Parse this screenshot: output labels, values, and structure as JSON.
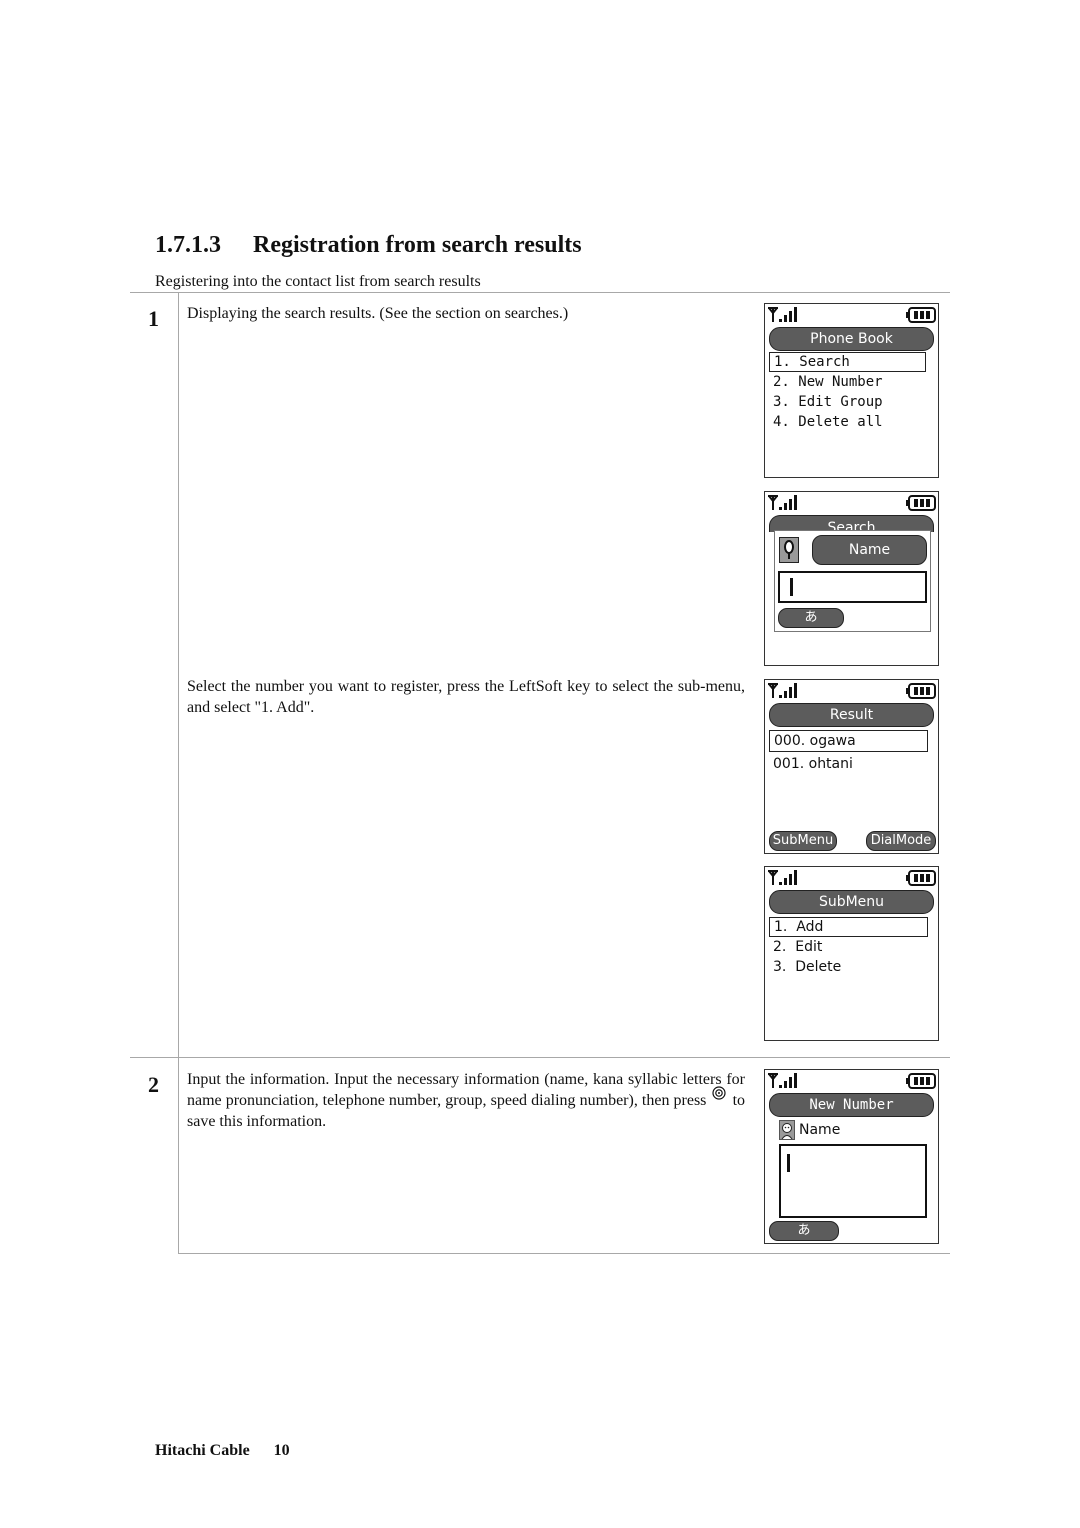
{
  "section": {
    "number": "1.7.1.3",
    "title": "Registration from search results",
    "subtitle": "Registering into the contact list from search results"
  },
  "steps": [
    {
      "number": "1",
      "paragraphs": [
        "Displaying the search results. (See the section on searches.)",
        "Select the number you want to register, press the LeftSoft key to select the sub-menu, and select \"1. Add\"."
      ]
    },
    {
      "number": "2",
      "text_before_icon": "Input the information. Input the necessary information (name, kana syllabic letters for name pronunciation, telephone number, group, speed dialing number), then press",
      "icon": "center-select-key-icon",
      "text_after_icon": "to save this information."
    }
  ],
  "screens": {
    "phone_book": {
      "title": "Phone Book",
      "items": [
        "1. Search",
        "2. New Number",
        "3. Edit Group",
        "4. Delete all"
      ],
      "selected_index": 0
    },
    "search": {
      "title": "Search",
      "field_label": "Name",
      "input_value": "",
      "input_mode": "あ"
    },
    "result": {
      "title": "Result",
      "items": [
        "000. ogawa",
        "001. ohtani"
      ],
      "selected_index": 0,
      "left_soft": "SubMenu",
      "right_soft": "DialMode"
    },
    "submenu": {
      "title": "SubMenu",
      "items": [
        "1.  Add",
        "2.  Edit",
        "3.  Delete"
      ],
      "selected_index": 0
    },
    "new_number": {
      "title": "New Number",
      "field_label": "Name",
      "input_value": "",
      "input_mode": "あ"
    }
  },
  "footer": {
    "company": "Hitachi Cable",
    "page": "10"
  }
}
